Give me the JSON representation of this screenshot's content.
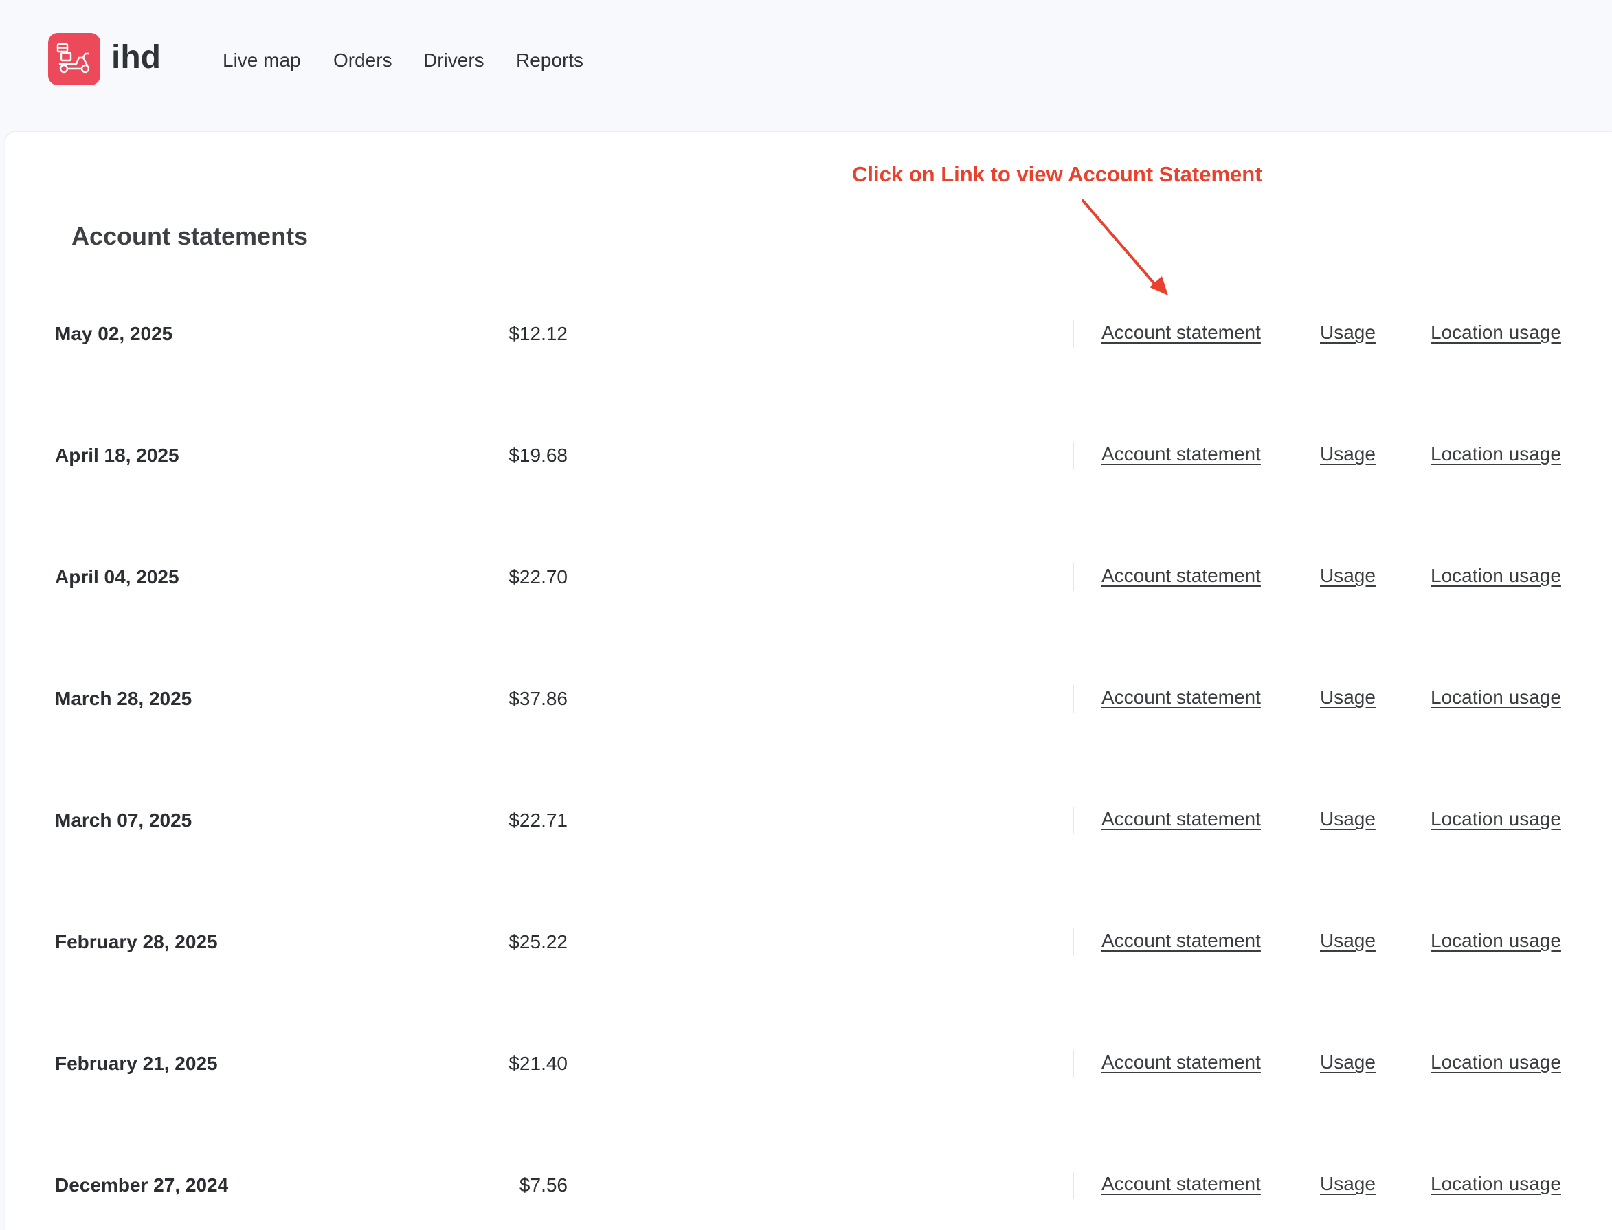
{
  "brand": {
    "name": "ihd",
    "logo_icon": "scooter-delivery-icon",
    "logo_color": "#ec4a5b"
  },
  "nav": {
    "items": [
      {
        "label": "Live map"
      },
      {
        "label": "Orders"
      },
      {
        "label": "Drivers"
      },
      {
        "label": "Reports"
      }
    ]
  },
  "annotation": {
    "text": "Click on Link to view Account Statement",
    "color": "#e8412d"
  },
  "page": {
    "title": "Account statements"
  },
  "statements": [
    {
      "date": "May 02, 2025",
      "amount": "$12.12",
      "statement_link": "Account statement",
      "usage_link": "Usage",
      "location_usage_link": "Location usage"
    },
    {
      "date": "April 18, 2025",
      "amount": "$19.68",
      "statement_link": "Account statement",
      "usage_link": "Usage",
      "location_usage_link": "Location usage"
    },
    {
      "date": "April 04, 2025",
      "amount": "$22.70",
      "statement_link": "Account statement",
      "usage_link": "Usage",
      "location_usage_link": "Location usage"
    },
    {
      "date": "March 28, 2025",
      "amount": "$37.86",
      "statement_link": "Account statement",
      "usage_link": "Usage",
      "location_usage_link": "Location usage"
    },
    {
      "date": "March 07, 2025",
      "amount": "$22.71",
      "statement_link": "Account statement",
      "usage_link": "Usage",
      "location_usage_link": "Location usage"
    },
    {
      "date": "February 28, 2025",
      "amount": "$25.22",
      "statement_link": "Account statement",
      "usage_link": "Usage",
      "location_usage_link": "Location usage"
    },
    {
      "date": "February 21, 2025",
      "amount": "$21.40",
      "statement_link": "Account statement",
      "usage_link": "Usage",
      "location_usage_link": "Location usage"
    },
    {
      "date": "December 27, 2024",
      "amount": "$7.56",
      "statement_link": "Account statement",
      "usage_link": "Usage",
      "location_usage_link": "Location usage"
    }
  ]
}
